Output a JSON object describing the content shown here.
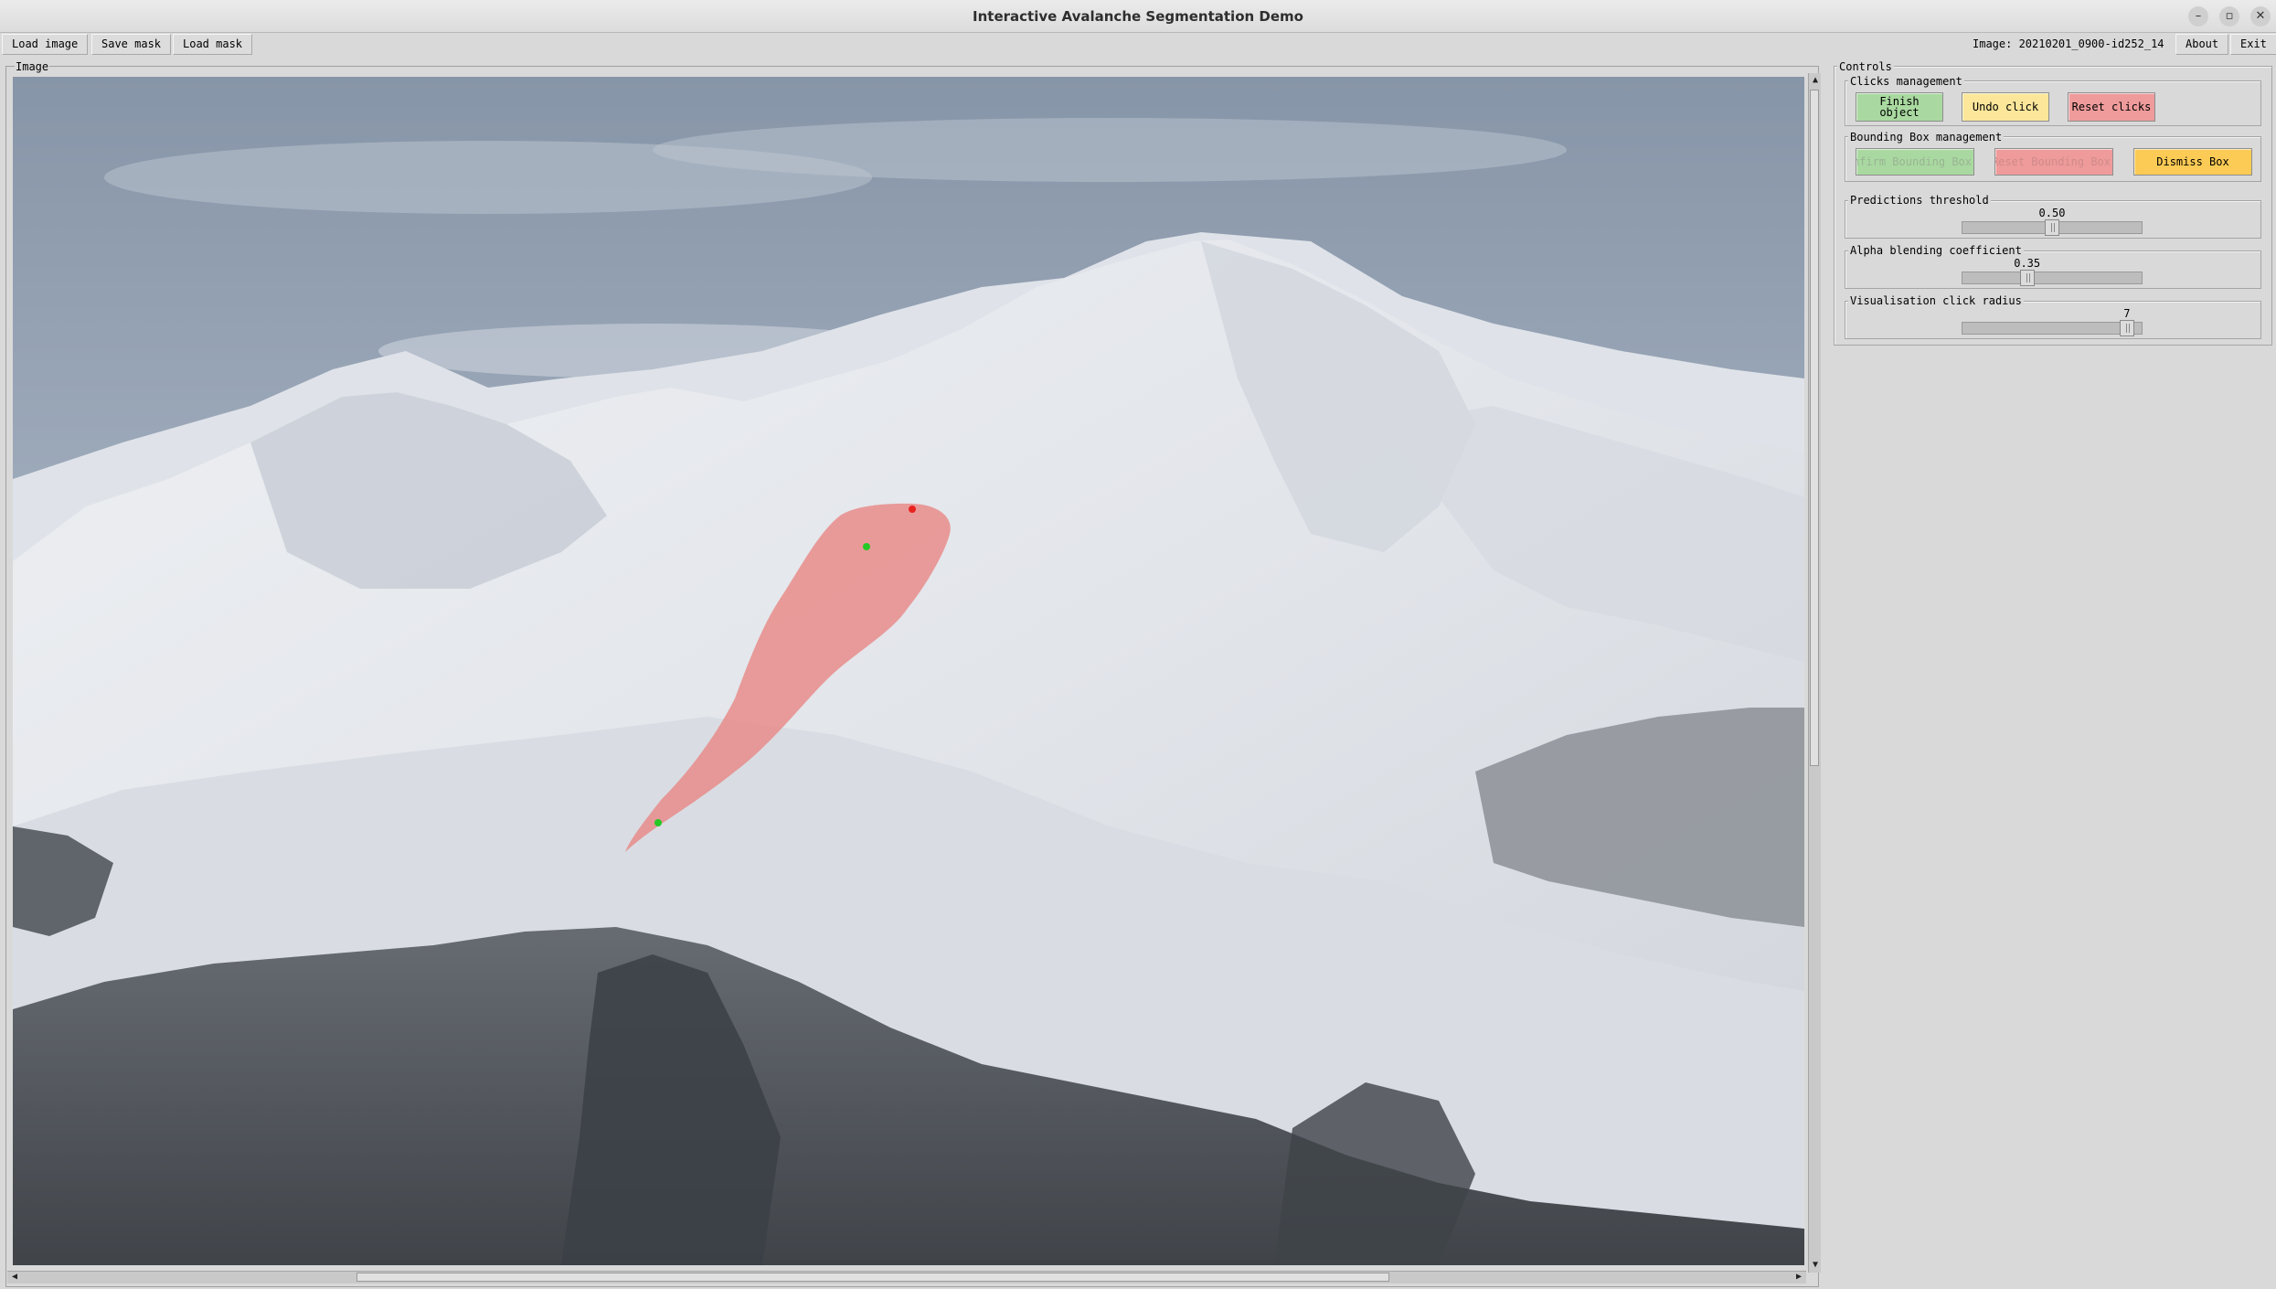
{
  "window": {
    "title": "Interactive Avalanche Segmentation Demo",
    "buttons": [
      "–",
      "▫",
      "✕"
    ]
  },
  "menu": {
    "load_image": "Load image",
    "save_mask": "Save mask",
    "load_mask": "Load mask",
    "image_name": "Image: 20210201_0900-id252_14",
    "about": "About",
    "exit": "Exit"
  },
  "image_panel": {
    "label": "Image",
    "clicks": [
      {
        "type": "negative",
        "color": "#e8231e"
      },
      {
        "type": "positive",
        "color": "#26c826"
      },
      {
        "type": "positive",
        "color": "#26c826"
      }
    ],
    "mask_color": "#e8807e"
  },
  "controls": {
    "label": "Controls",
    "clicks_management": {
      "label": "Clicks management",
      "finish_object": "Finish\nobject",
      "undo_click": "Undo click",
      "reset_clicks": "Reset clicks"
    },
    "bounding_box_management": {
      "label": "Bounding Box management",
      "confirm_box": "Confirm Bounding Box",
      "reset_box": "Reset Bounding Box",
      "dismiss_box": "Dismiss Box"
    },
    "predictions_threshold": {
      "label": "Predictions threshold",
      "value": "0.50",
      "fraction": 0.5
    },
    "alpha_blending": {
      "label": "Alpha blending coefficient",
      "value": "0.35",
      "fraction": 0.35
    },
    "click_radius": {
      "label": "Visualisation click radius",
      "value": "7",
      "fraction": 0.95
    }
  }
}
